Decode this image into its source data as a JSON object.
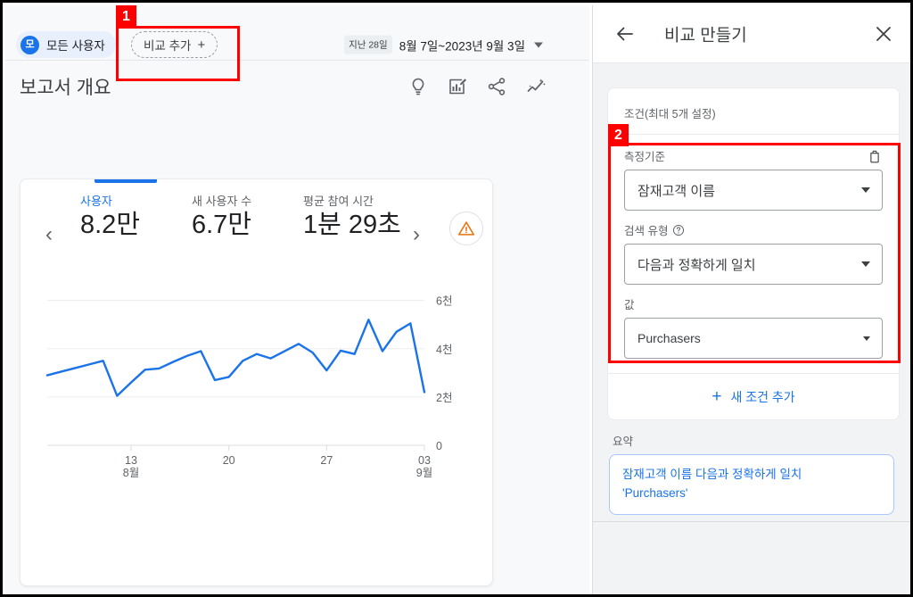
{
  "left": {
    "topbar": {
      "avatar_initial": "모",
      "user_chip_label": "모든 사용자",
      "compare_chip_label": "비교 추가",
      "compare_plus": "+",
      "date_badge": "지난 28일",
      "date_range": "8월 7일~2023년 9월 3일"
    },
    "report": {
      "title": "보고서 개요",
      "toolbar_icons": [
        "lightbulb-icon",
        "edit-chart-icon",
        "share-icon",
        "trend-sparkle-icon"
      ]
    },
    "card": {
      "metrics": [
        {
          "label": "사용자",
          "value": "8.2만",
          "active": true
        },
        {
          "label": "새 사용자 수",
          "value": "6.7만",
          "active": false
        },
        {
          "label": "평균 참여 시간",
          "value": "1분 29초",
          "active": false
        }
      ],
      "prev_arrow": "‹",
      "next_arrow": "›",
      "warning_icon": "warning-triangle-icon"
    }
  },
  "chart_data": {
    "type": "line",
    "title": "",
    "xlabel": "",
    "ylabel": "",
    "ylim": [
      0,
      6800
    ],
    "ytick_labels": [
      "6천",
      "4천",
      "2천",
      "0"
    ],
    "ytick_values": [
      6000,
      4000,
      2000,
      0
    ],
    "xtick_labels": [
      "13",
      "20",
      "27",
      "03"
    ],
    "xtick_sublabels": [
      "8월",
      "",
      "",
      "9월"
    ],
    "xtick_indices": [
      6,
      13,
      20,
      27
    ],
    "grid": true,
    "series": [
      {
        "name": "사용자",
        "color": "#1a73e8",
        "values": [
          2900,
          3050,
          3200,
          3350,
          3500,
          2050,
          2600,
          3130,
          3180,
          3450,
          3700,
          3900,
          2700,
          2830,
          3500,
          3780,
          3600,
          3900,
          4200,
          3840,
          3100,
          3920,
          3780,
          5200,
          3900,
          4700,
          5050,
          2200
        ]
      }
    ]
  },
  "right": {
    "header": {
      "back_icon": "arrow-left-icon",
      "title": "비교 만들기",
      "close_icon": "close-icon"
    },
    "conditions_card": {
      "title": "조건(최대 5개 설정)",
      "delete_icon": "trash-icon",
      "fields": [
        {
          "label": "측정기준",
          "value": "잠재고객 이름",
          "has_help": false
        },
        {
          "label": "검색 유형",
          "value": "다음과 정확하게 일치",
          "has_help": true
        },
        {
          "label": "값",
          "value": "Purchasers",
          "has_help": false
        }
      ],
      "add_condition_label": "새 조건 추가",
      "add_condition_plus": "+"
    },
    "summary": {
      "label": "요약",
      "line1": "잠재고객 이름 다음과 정확하게 일치",
      "line2": "'Purchasers'"
    }
  },
  "annotations": [
    {
      "number": "1",
      "target": "compare-chip"
    },
    {
      "number": "2",
      "target": "condition-block"
    }
  ],
  "colors": {
    "accent_blue": "#1a73e8",
    "annotation_red": "#ff0000",
    "warning_orange": "#e8710a",
    "panel_bg": "#f1f3f4"
  }
}
